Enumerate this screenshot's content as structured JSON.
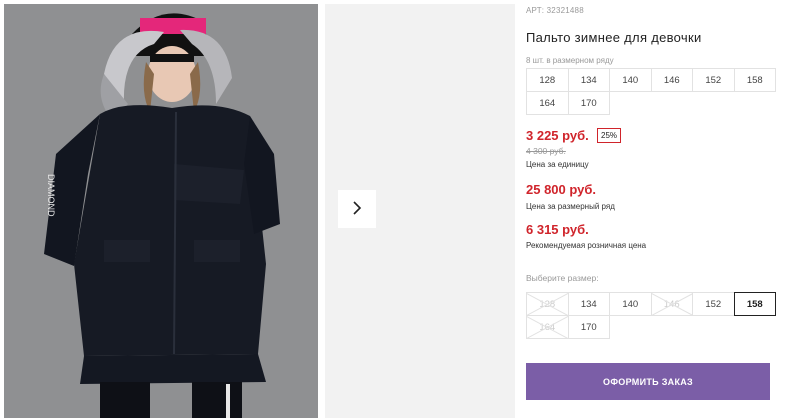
{
  "product": {
    "sku_label": "АРТ: 32321488",
    "title": "Пальто зимнее для девочки",
    "per_row_label": "8 шт. в размерном ряду"
  },
  "row_sizes": [
    "128",
    "134",
    "140",
    "146",
    "152",
    "158",
    "164",
    "170"
  ],
  "pricing": {
    "unit_price": "3 225 руб.",
    "discount": "25%",
    "old_price": "4 300 руб.",
    "unit_caption": "Цена за единицу",
    "row_price": "25 800 руб.",
    "row_caption": "Цена за размерный ряд",
    "rrp_price": "6 315 руб.",
    "rrp_caption": "Рекомендуемая розничная цена"
  },
  "size_picker": {
    "label": "Выберите размер:",
    "options": [
      {
        "label": "128",
        "available": false
      },
      {
        "label": "134",
        "available": true
      },
      {
        "label": "140",
        "available": true
      },
      {
        "label": "146",
        "available": false
      },
      {
        "label": "152",
        "available": true
      },
      {
        "label": "158",
        "available": true,
        "selected": true
      },
      {
        "label": "164",
        "available": false
      },
      {
        "label": "170",
        "available": true
      }
    ]
  },
  "actions": {
    "order_label": "ОФОРМИТЬ ЗАКАЗ",
    "next_icon": "chevron-right-icon"
  },
  "colors": {
    "price_red": "#d0242b",
    "button_purple": "#7b5ea7"
  }
}
